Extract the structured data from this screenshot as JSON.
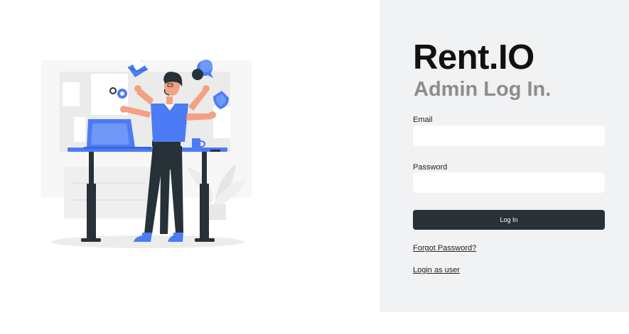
{
  "brand": "Rent.IO",
  "subtitle": "Admin Log In.",
  "form": {
    "email_label": "Email",
    "email_value": "",
    "password_label": "Password",
    "password_value": "",
    "login_label": "Log In",
    "forgot_label": "Forgot Password?",
    "user_login_label": "Login as user"
  },
  "colors": {
    "panel_bg": "#f1f2f4",
    "button_bg": "#283038",
    "accent_blue": "#4b7bf5",
    "subtitle_gray": "#8d8d8d"
  },
  "illustration": {
    "icons": [
      "envelope-icon",
      "chat-bubbles-icon",
      "gears-icon",
      "shield-icon",
      "laptop-icon",
      "mug-icon",
      "plant-icon"
    ]
  }
}
